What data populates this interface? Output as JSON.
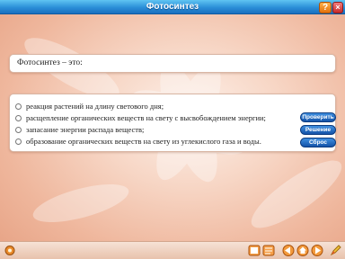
{
  "window": {
    "title": "Фотосинтез",
    "help_glyph": "?",
    "close_glyph": "×"
  },
  "question": {
    "text": "Фотосинтез – это:"
  },
  "answers": {
    "options": [
      "реакция растений на длину светового дня;",
      "расщепление органических веществ на свету с высвобождением энергии;",
      "запасание энергии распада веществ;",
      "образование органических веществ на свету из углекислого газа и воды."
    ]
  },
  "buttons": {
    "check": "Проверить",
    "solution": "Решение",
    "reset": "Сброс"
  },
  "bottom_toolbar": {
    "icons": [
      "settings-icon",
      "pages-icon",
      "notebook-icon",
      "back-icon",
      "home-icon",
      "forward-icon",
      "pen-icon"
    ]
  },
  "colors": {
    "titlebar": "#2b8fd8",
    "button_blue": "#1553a8",
    "background": "#f7d6c5"
  }
}
